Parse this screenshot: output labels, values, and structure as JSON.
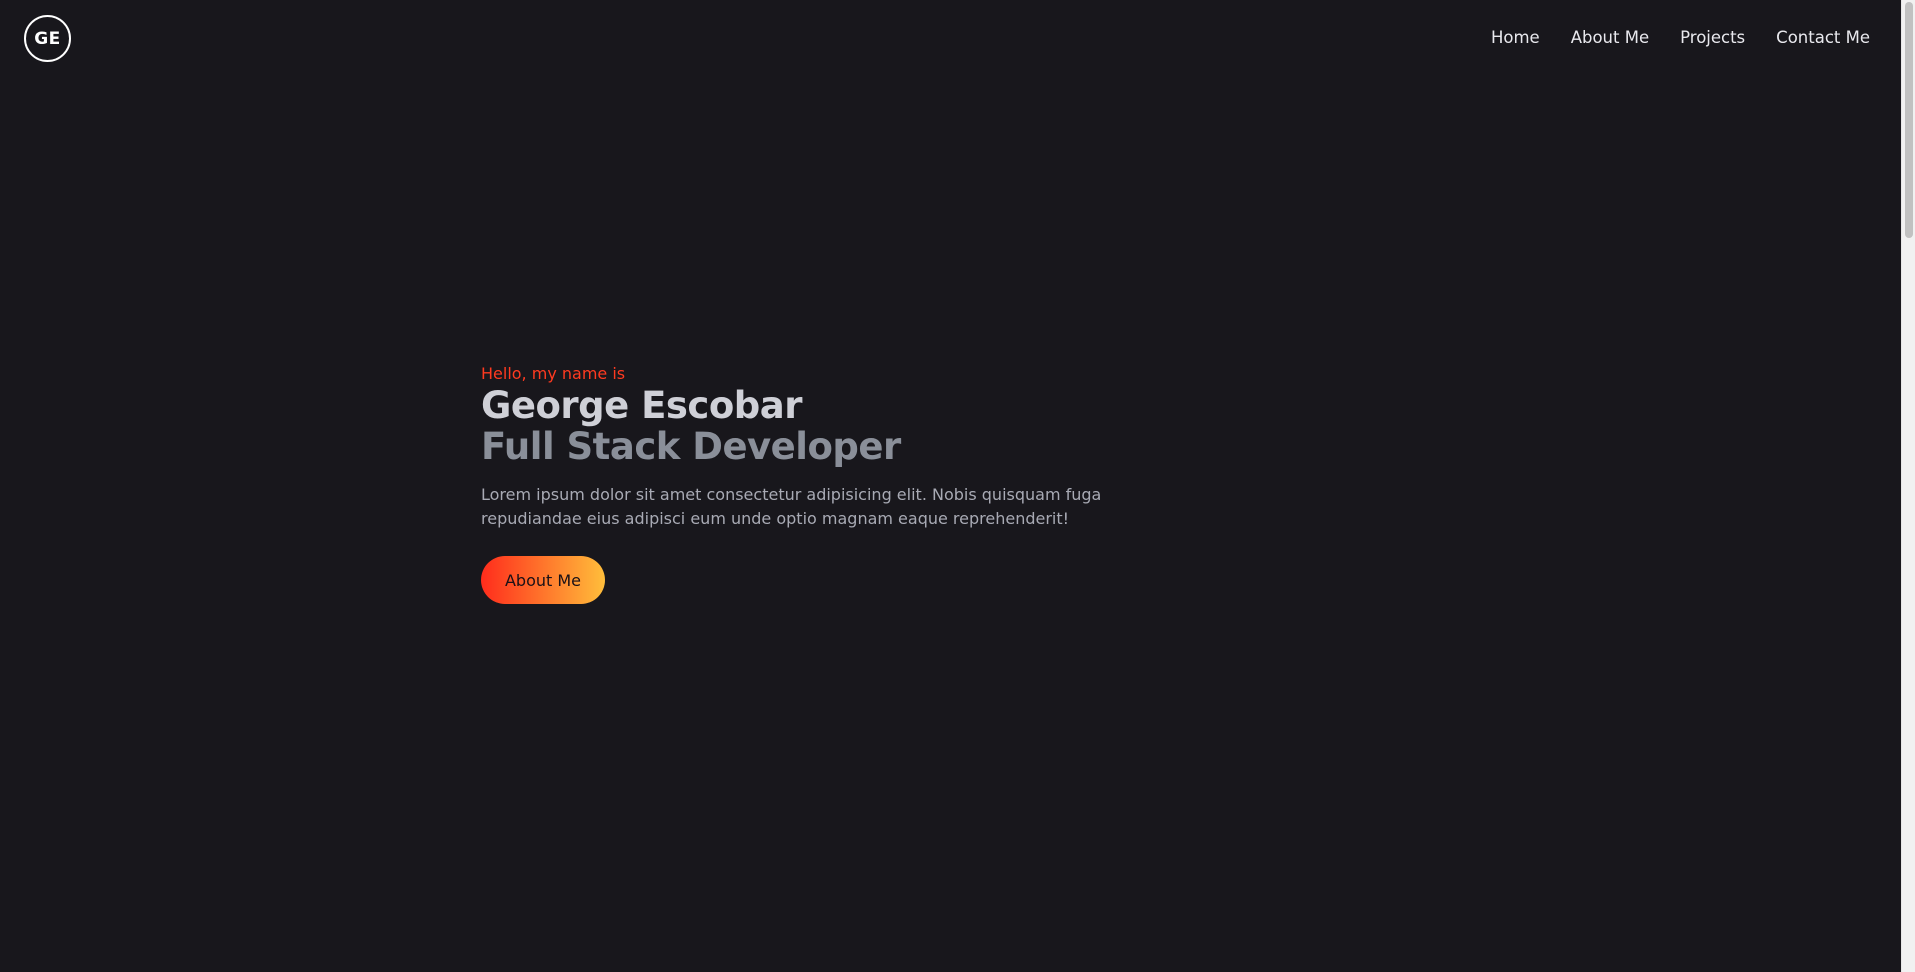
{
  "header": {
    "logo_text": "GE",
    "nav": [
      {
        "label": "Home"
      },
      {
        "label": "About Me"
      },
      {
        "label": "Projects"
      },
      {
        "label": "Contact Me"
      }
    ]
  },
  "hero": {
    "greeting": "Hello, my name is",
    "name": "George Escobar",
    "role": "Full Stack Developer",
    "description": "Lorem ipsum dolor sit amet consectetur adipisicing elit. Nobis quisquam fuga repudiandae eius adipisci eum unde optio magnam eaque reprehenderit!",
    "cta_label": "About Me"
  },
  "colors": {
    "background": "#18171c",
    "accent_red": "#ff3a20",
    "gradient_start": "#ff2c1c",
    "gradient_end": "#ffbe3b",
    "name_color": "#cfd0d7",
    "role_color": "#8a8f99"
  }
}
